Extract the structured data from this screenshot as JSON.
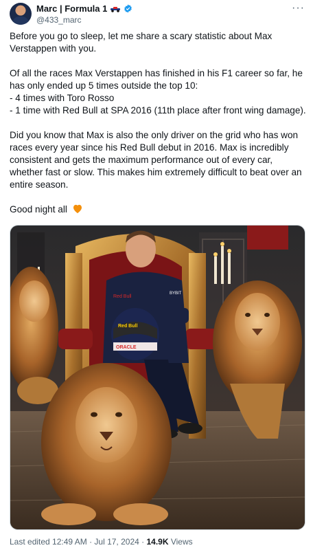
{
  "author": {
    "display_name": "Marc | Formula 1",
    "handle": "@433_marc",
    "icons": [
      "car-icon",
      "verified-icon"
    ]
  },
  "menu_icon": "more-icon",
  "tweet": {
    "p1": "Before you go to sleep, let me share a scary statistic about Max Verstappen with you.",
    "p2_intro": "Of all the races Max Verstappen has finished in his F1 career so far, he has only ended up 5 times outside the top 10:",
    "p2_line1": "- 4 times with Toro Rosso",
    "p2_line2": "- 1 time with Red Bull at SPA 2016 (11th place after front wing damage).",
    "p3": "Did you know that Max is also the only driver on the grid who has won races every year since his Red Bull debut in 2016. Max is incredibly consistent and gets the maximum performance out of every car, whether fast or slow. This makes him extremely difficult to beat over an entire season.",
    "p4": "Good night all",
    "emoji": "orange-heart-icon"
  },
  "image": {
    "helmet_text_1": "Red Bull",
    "helmet_text_2": "ORACLE",
    "suit_text": "Red Bull",
    "bybit": "BYBIT"
  },
  "footer": {
    "edited": "Last edited 12:49 AM · Jul 17, 2024 · ",
    "views_count": "14.9K",
    "views_label": " Views"
  },
  "colors": {
    "accent_blue": "#1d9bf0",
    "text": "#0f1419",
    "muted": "#536471",
    "heart": "#f4900c"
  }
}
